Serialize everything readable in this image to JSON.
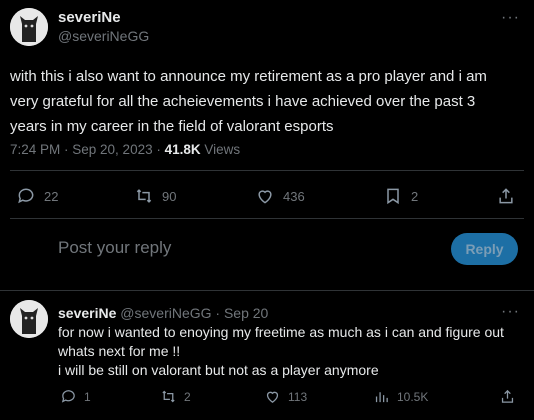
{
  "tweet": {
    "display_name": "severiNe",
    "handle": "@severiNeGG",
    "more_icon": "more-dots-icon",
    "text": "with this i also want to announce my retirement as a pro player and i am very grateful for all the acheievements i have achieved over the past 3 years in my career in the field of valorant esports",
    "time": "7:24 PM · Sep 20, 2023 · ",
    "views_count": "41.8K",
    "views_label": " Views",
    "actions": {
      "replies": "22",
      "retweets": "90",
      "likes": "436",
      "bookmarks": "2"
    }
  },
  "composer": {
    "placeholder": "Post your reply",
    "button_label": "Reply"
  },
  "reply": {
    "display_name": "severiNe",
    "handle_date": "@severiNeGG · Sep 20",
    "text_line1": "for now i wanted to enoying my freetime as much as i can and figure out whats next for me !!",
    "text_line2": "i will be still on valorant but not as a player anymore",
    "actions": {
      "replies": "1",
      "retweets": "2",
      "likes": "113",
      "views": "10.5K"
    }
  },
  "colors": {
    "background": "#000000",
    "text": "#e7e9ea",
    "muted": "#71767b",
    "divider": "#2f3336",
    "reply_button": "#1d6fa5"
  }
}
